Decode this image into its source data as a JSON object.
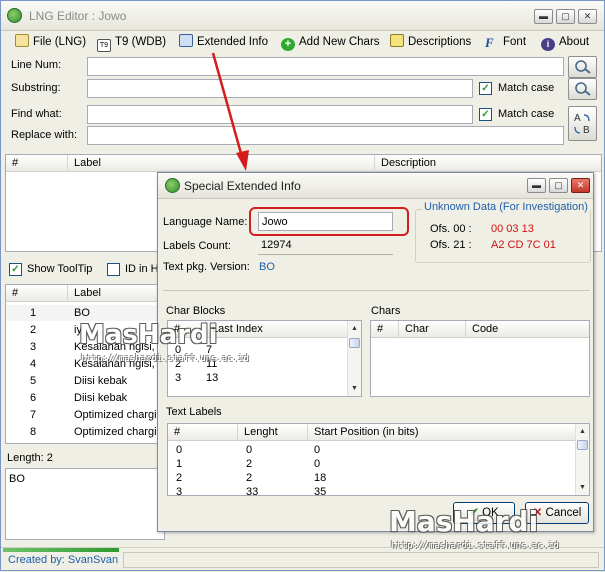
{
  "window": {
    "title": "LNG Editor : Jowo",
    "min": "▬",
    "max": "▢",
    "close": "✕"
  },
  "menu": [
    {
      "label": "File (LNG)",
      "icon": "file-pen-icon"
    },
    {
      "label": "T9 (WDB)",
      "icon": "t9-icon"
    },
    {
      "label": "Extended Info",
      "icon": "monitor-icon"
    },
    {
      "label": "Add New Chars",
      "icon": "plus-circle-icon"
    },
    {
      "label": "Descriptions",
      "icon": "notepad-icon"
    },
    {
      "label": "Font",
      "icon": "font-icon"
    },
    {
      "label": "About",
      "icon": "info-icon"
    }
  ],
  "form": {
    "line_num": "Line Num:",
    "substring": "Substring:",
    "find_what": "Find what:",
    "replace_with": "Replace with:",
    "match_case_1": "Match case",
    "match_case_2": "Match case"
  },
  "top_table": {
    "headers": [
      "#",
      "Label",
      "Description"
    ]
  },
  "options": {
    "show_tooltip": "Show ToolTip",
    "id_in": "ID in H"
  },
  "main_table": {
    "headers": [
      "#",
      "Label"
    ],
    "rows": [
      [
        "1",
        "BO"
      ],
      [
        "2",
        "iy"
      ],
      [
        "3",
        "Kesalahan ngisi, s"
      ],
      [
        "4",
        "Kesalahan ngisi, s"
      ],
      [
        "5",
        "Diisi kebak"
      ],
      [
        "6",
        "Diisi kebak"
      ],
      [
        "7",
        "Optimized chargin"
      ],
      [
        "8",
        "Optimized chargin"
      ]
    ]
  },
  "length_label": "Length: 2",
  "editor_text": "BO",
  "status": "Created by: SvanSvan",
  "dialog": {
    "title": "Special Extended Info",
    "lang_name_label": "Language Name:",
    "lang_name": "Jowo",
    "labels_count_label": "Labels Count:",
    "labels_count": "12974",
    "text_pkg_label": "Text pkg. Version:",
    "text_pkg": "BO",
    "unknown_title": "Unknown Data (For Investigation)",
    "ofs00_label": "Ofs. 00 :",
    "ofs00_value": "00 03 13",
    "ofs21_label": "Ofs. 21 :",
    "ofs21_value": "A2 CD 7C 01",
    "char_blocks_title": "Char Blocks",
    "char_blocks_headers": [
      "#",
      "Last Index"
    ],
    "char_blocks_rows": [
      [
        "0",
        "7"
      ],
      [
        "2",
        "11"
      ],
      [
        "3",
        "13"
      ]
    ],
    "chars_title": "Chars",
    "chars_headers": [
      "#",
      "Char",
      "Code"
    ],
    "text_labels_title": "Text Labels",
    "text_labels_headers": [
      "#",
      "Lenght",
      "Start Position (in bits)"
    ],
    "text_labels_rows": [
      [
        "0",
        "0",
        "0"
      ],
      [
        "1",
        "2",
        "0"
      ],
      [
        "2",
        "2",
        "18"
      ],
      [
        "3",
        "33",
        "35"
      ]
    ],
    "ok": "OK",
    "cancel": "Cancel"
  },
  "watermark": {
    "brand": "MasHardi",
    "url": "http://mashardi.staff.uns.ac.id"
  },
  "colors": {
    "accent_blue": "#1f5fa8",
    "ofs_red": "#d01010",
    "highlight_red": "#d12020",
    "title_gray": "#8b8b8b"
  }
}
